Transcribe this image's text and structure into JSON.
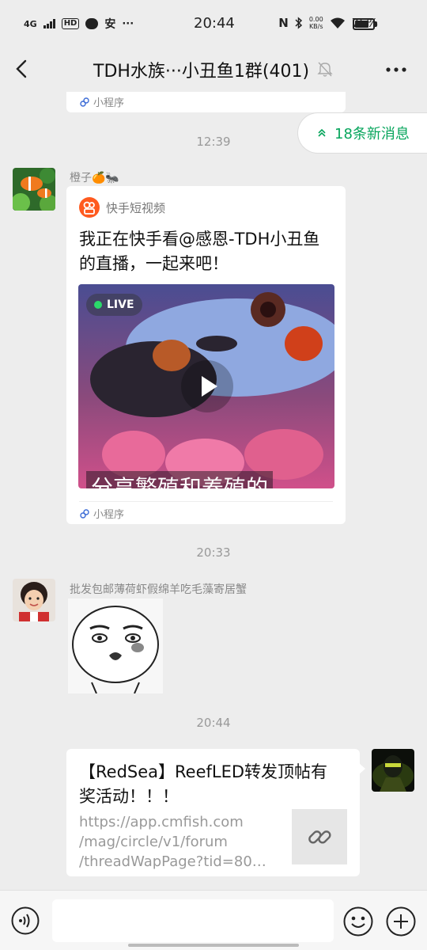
{
  "status_bar": {
    "network": "4G",
    "hd": "HD",
    "app_glyph": "安",
    "dots": "···",
    "time": "20:44",
    "nfc": "N",
    "speed_value": "0.00",
    "speed_unit": "KB/s",
    "battery": "75%"
  },
  "header": {
    "title": "TDH水族···小丑鱼1群(401)"
  },
  "chat": {
    "top_card_footer": "小程序",
    "new_messages": "18条新消息",
    "messages": [
      {
        "timestamp": "12:39",
        "sender": "橙子🍊🐜",
        "app_name": "快手短视频",
        "title": "我正在快手看@感恩-TDH小丑鱼的直播，一起来吧！",
        "live_label": "LIVE",
        "video_caption": "分享繁殖和养殖的",
        "footer": "小程序"
      },
      {
        "timestamp": "20:33",
        "sender": "批发包邮薄荷虾假绵羊吃毛藻寄居蟹"
      },
      {
        "timestamp": "20:44",
        "title": "【RedSea】ReefLED转发顶帖有奖活动！！！",
        "desc_lines": [
          "https://app.cmfish.com",
          "/mag/circle/v1/forum",
          "/threadWapPage?tid=80…"
        ]
      }
    ]
  },
  "input_bar": {
    "placeholder": ""
  },
  "colors": {
    "accent_green": "#07a55c",
    "background": "#ededed",
    "kuaishou_orange": "#ff5a1f"
  }
}
